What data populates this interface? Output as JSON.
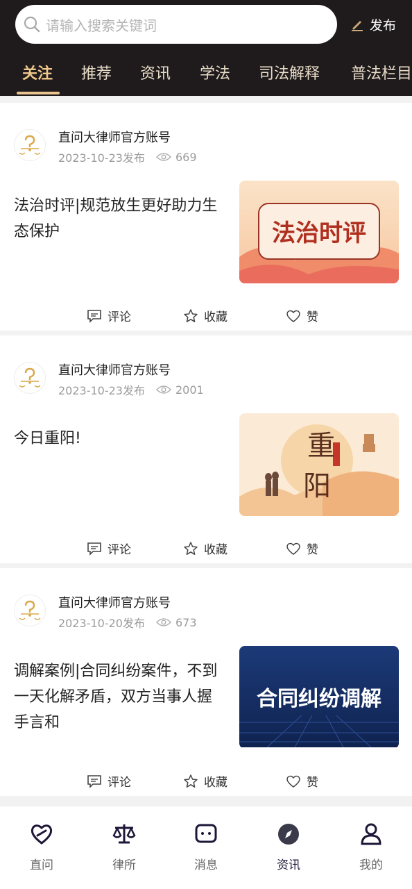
{
  "search": {
    "placeholder": "请输入搜索关键词",
    "publish_label": "发布"
  },
  "tabs": [
    {
      "label": "关注",
      "active": true
    },
    {
      "label": "推荐"
    },
    {
      "label": "资讯"
    },
    {
      "label": "学法"
    },
    {
      "label": "司法解释"
    },
    {
      "label": "普法栏目"
    }
  ],
  "posts": [
    {
      "author": "直问大律师官方账号",
      "date": "2023-10-23发布",
      "views": "669",
      "title": "法治时评|规范放生更好助力生态保护",
      "thumb_text": "法治时评",
      "actions": {
        "comment": "评论",
        "favorite": "收藏",
        "like": "赞"
      }
    },
    {
      "author": "直问大律师官方账号",
      "date": "2023-10-23发布",
      "views": "2001",
      "title": "今日重阳!",
      "thumb_text_top": "重",
      "thumb_text_bottom": "阳",
      "actions": {
        "comment": "评论",
        "favorite": "收藏",
        "like": "赞"
      }
    },
    {
      "author": "直问大律师官方账号",
      "date": "2023-10-20发布",
      "views": "673",
      "title": "调解案例|合同纠纷案件，不到一天化解矛盾，双方当事人握手言和",
      "thumb_text": "合同纠纷调解",
      "actions": {
        "comment": "评论",
        "favorite": "收藏",
        "like": "赞"
      }
    }
  ],
  "bottom_nav": [
    {
      "label": "直问",
      "icon": "heart-link-icon"
    },
    {
      "label": "律所",
      "icon": "scales-icon"
    },
    {
      "label": "消息",
      "icon": "chat-bubble-icon"
    },
    {
      "label": "资讯",
      "icon": "compass-icon",
      "active": true
    },
    {
      "label": "我的",
      "icon": "user-icon"
    }
  ],
  "colors": {
    "header_bg": "#1f1b1c",
    "accent_gold": "#e9c48e",
    "nav_dark": "#1e1638"
  }
}
